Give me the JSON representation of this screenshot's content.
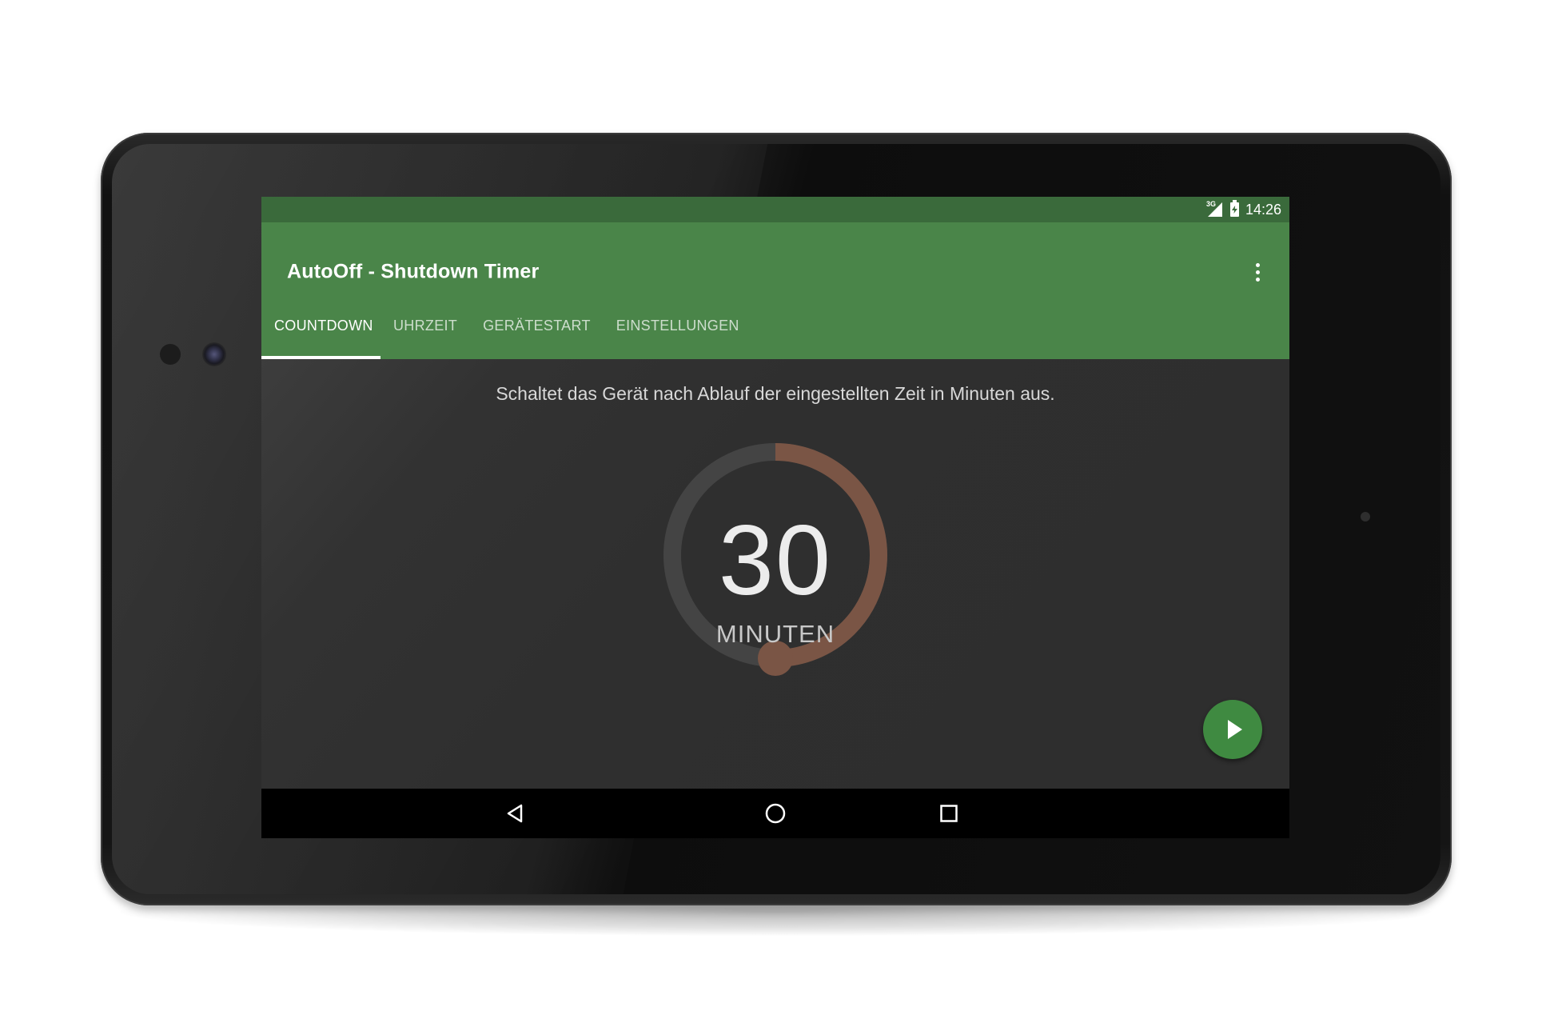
{
  "status_bar": {
    "network_label": "3G",
    "time": "14:26",
    "icons": [
      "signal-icon",
      "battery-charging-icon"
    ]
  },
  "app_bar": {
    "title": "AutoOff - Shutdown Timer",
    "overflow_icon": "more-vert-icon"
  },
  "tabs": [
    {
      "label": "COUNTDOWN",
      "active": true
    },
    {
      "label": "UHRZEIT",
      "active": false
    },
    {
      "label": "GERÄTESTART",
      "active": false
    },
    {
      "label": "EINSTELLUNGEN",
      "active": false
    }
  ],
  "countdown": {
    "description": "Schaltet das Gerät nach Ablauf der eingestellten Zeit in Minuten aus.",
    "value": "30",
    "unit": "MINUTEN",
    "dial_fraction": 0.5,
    "start_button_icon": "play-icon"
  },
  "nav_bar": {
    "icons": [
      "back-icon",
      "home-icon",
      "recents-icon"
    ]
  },
  "colors": {
    "primary": "#4a8549",
    "primary_dark": "#3a6a3b",
    "accent": "#3f8a41",
    "dial_track": "#444444",
    "dial_progress": "#7a5545",
    "background": "#303030"
  }
}
